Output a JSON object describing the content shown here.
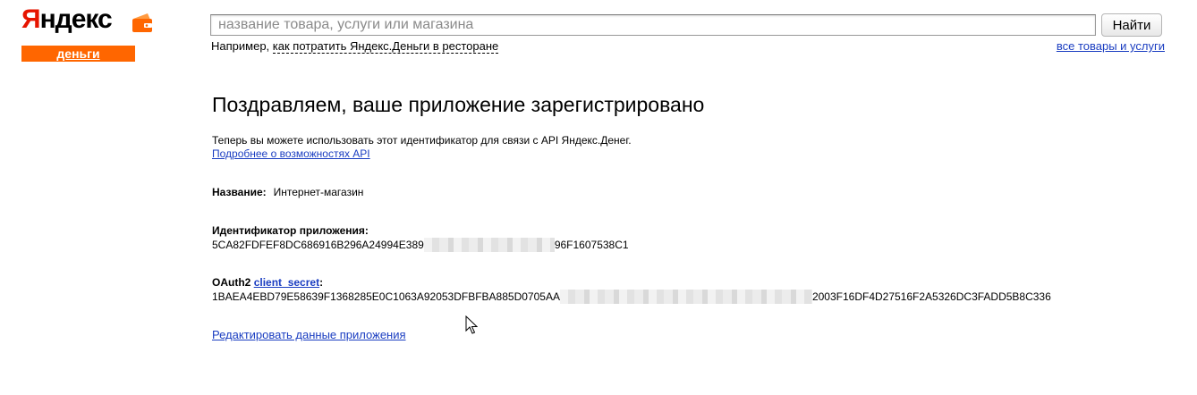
{
  "logo": {
    "word_first": "Я",
    "word_rest": "ндекс",
    "sub": "деньги"
  },
  "search": {
    "placeholder": "название товара, услуги или магазина",
    "button": "Найти",
    "example_prefix": "Например,",
    "example_link": "как потратить Яндекс.Деньги в ресторане",
    "all_link": "все товары и услуги"
  },
  "main": {
    "title": "Поздравляем, ваше приложение зарегистрировано",
    "intro_text": "Теперь вы можете использовать этот идентификатор для связи с API Яндекс.Денег.",
    "api_link": "Подробнее о возможностях API",
    "name_label": "Название:",
    "name_value": "Интернет-магазин",
    "appid_label": "Идентификатор приложения:",
    "appid_start": "5CA82FDFEF8DC686916B296A24994E389",
    "appid_end": "96F1607538C1",
    "secret_prefix": "OAuth2",
    "secret_link": "client_secret",
    "secret_colon": ":",
    "secret_start": "1BAEA4EBD79E58639F1368285E0C1063A92053DFBFBA885D0705AA",
    "secret_end": "2003F16DF4D27516F2A5326DC3FADD5B8C336",
    "edit_link": "Редактировать данные приложения"
  },
  "colors": {
    "brand_red": "#e61400",
    "brand_orange": "#ff6600",
    "link": "#1a3dc1"
  }
}
